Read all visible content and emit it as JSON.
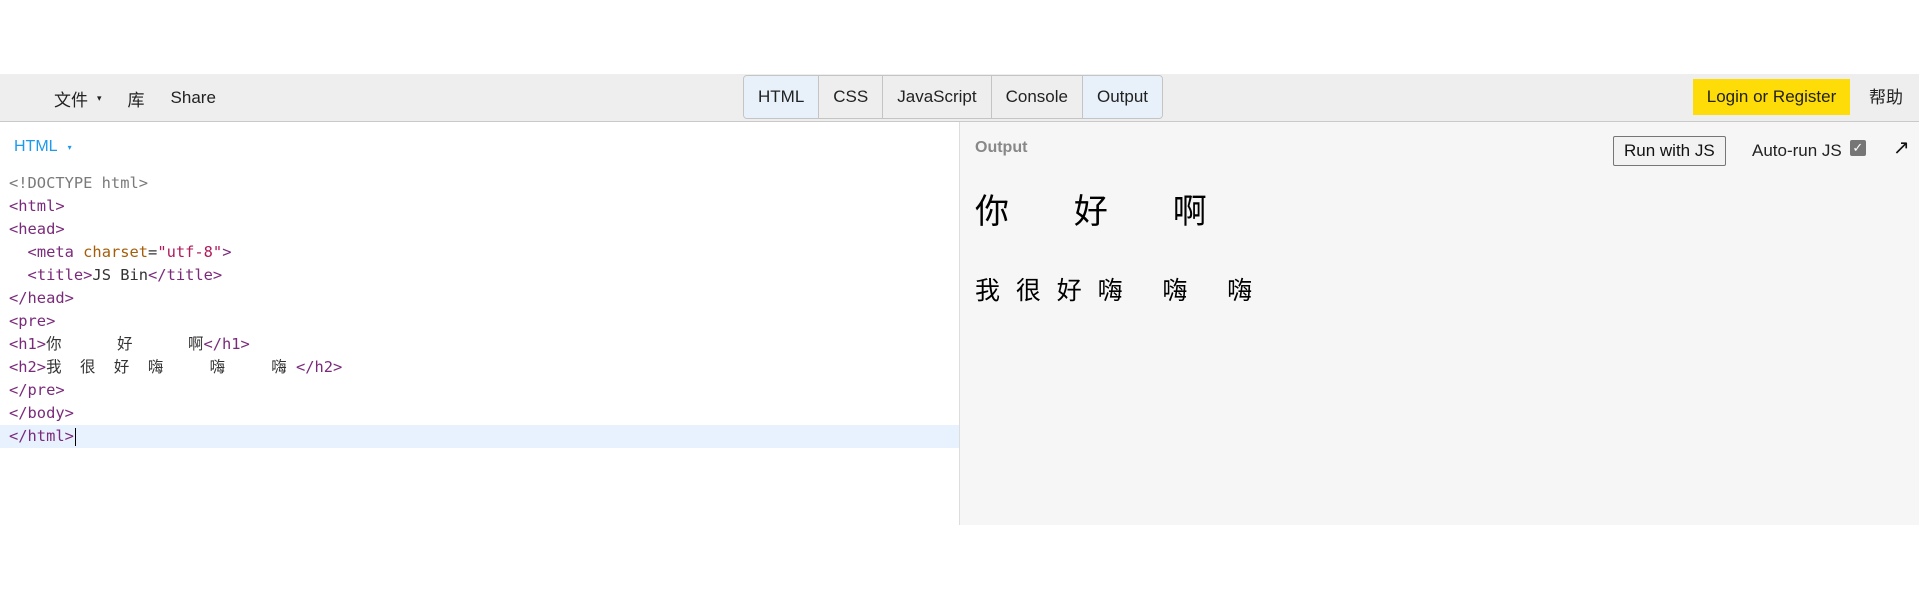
{
  "toolbar": {
    "menu": [
      {
        "label": "文件",
        "has_caret": true
      },
      {
        "label": "库"
      },
      {
        "label": "Share"
      }
    ],
    "panels": [
      {
        "label": "HTML",
        "active": true
      },
      {
        "label": "CSS",
        "active": false
      },
      {
        "label": "JavaScript",
        "active": false
      },
      {
        "label": "Console",
        "active": false
      },
      {
        "label": "Output",
        "active": true
      }
    ],
    "login_label": "Login or Register",
    "help_label": "帮助"
  },
  "editor": {
    "panel_label": "HTML",
    "lines": [
      "<!DOCTYPE html>",
      "<html>",
      "<head>",
      "  <meta charset=\"utf-8\">",
      "  <title>JS Bin</title>",
      "</head>",
      "<pre>",
      "<h1>你      好      啊</h1>",
      "<h2>我  很  好  嗨     嗨     嗨 </h2>",
      "</pre>",
      "</body>",
      "</html>"
    ],
    "h1_text": "你      好      啊",
    "h2_text": "我  很  好  嗨     嗨     嗨 ",
    "meta_attr": "charset",
    "meta_value": "\"utf-8\"",
    "title_text": "JS Bin"
  },
  "output": {
    "panel_label": "Output",
    "run_button": "Run with JS",
    "autorun_label": "Auto-run JS",
    "autorun_checked": true,
    "h1": "你      好      啊",
    "h2": "我  很  好  嗨     嗨     嗨 "
  },
  "icons": {
    "caret": "▾",
    "checkmark": "✓",
    "popout": "↗"
  }
}
